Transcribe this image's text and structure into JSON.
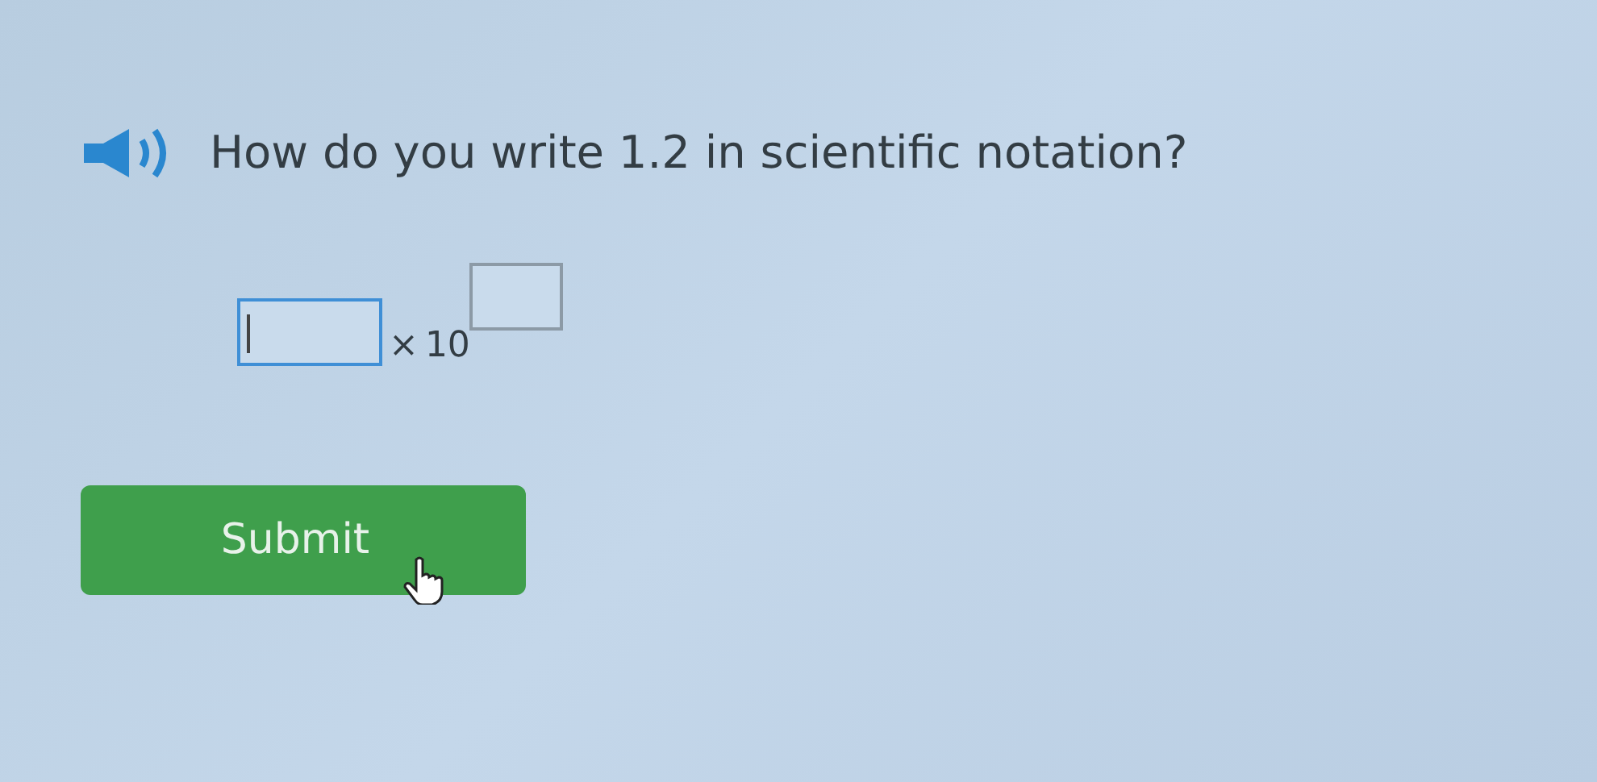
{
  "question": {
    "text": "How do you write 1.2 in scientific notation?"
  },
  "answer": {
    "coefficient": {
      "focused": true
    },
    "times": "×",
    "base": "10",
    "exponent": {
      "focused": false
    }
  },
  "submit": {
    "label": "Submit"
  }
}
